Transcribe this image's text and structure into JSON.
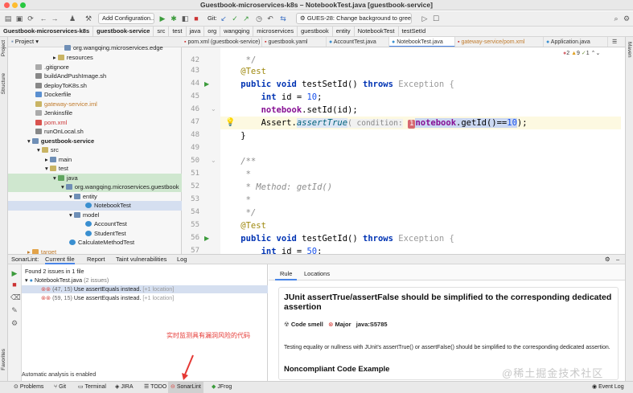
{
  "window": {
    "title": "Guestbook-microservices-k8s – NotebookTest.java [guestbook-service]"
  },
  "toolbar": {
    "add_config": "Add Configuration...",
    "git_label": "Git:",
    "branch": "GUES-28: Change background to green"
  },
  "breadcrumbs": [
    "Guestbook-microservices-k8s",
    "guestbook-service",
    "src",
    "test",
    "java",
    "org",
    "wangqing",
    "microservices",
    "guestbook",
    "entity",
    "NotebookTest",
    "testSetId"
  ],
  "side_strip": {
    "left_top": "Project",
    "left_mid": "Structure",
    "left_bottom": "Favorites",
    "right_top": "Maven"
  },
  "project": {
    "header": "Project",
    "items": [
      {
        "label": "org.wangqing.microservices.edge"
      },
      {
        "label": "resources"
      },
      {
        "label": ".gitignore"
      },
      {
        "label": "buildAndPushImage.sh"
      },
      {
        "label": "deployToK8s.sh"
      },
      {
        "label": "Dockerfile"
      },
      {
        "label": "gateway-service.iml"
      },
      {
        "label": "Jenkinsfile"
      },
      {
        "label": "pom.xml"
      },
      {
        "label": "runOnLocal.sh"
      },
      {
        "label": "guestbook-service"
      },
      {
        "label": "src"
      },
      {
        "label": "main"
      },
      {
        "label": "test"
      },
      {
        "label": "java"
      },
      {
        "label": "org.wangqing.microservices.guestbook"
      },
      {
        "label": "entity"
      },
      {
        "label": "NotebookTest"
      },
      {
        "label": "model"
      },
      {
        "label": "AccountTest"
      },
      {
        "label": "StudentTest"
      },
      {
        "label": "CalculateMethodTest"
      },
      {
        "label": "target"
      }
    ]
  },
  "editor_tabs": [
    "pom.xml (guestbook-service)",
    "guestbook.yaml",
    "AccountTest.java",
    "NotebookTest.java",
    "gateway-service/pom.xml",
    "Application.java"
  ],
  "warnings": {
    "errors": "2",
    "warns": "9",
    "other": "1"
  },
  "code": {
    "line_numbers": [
      "42",
      "43",
      "44",
      "45",
      "46",
      "47",
      "48",
      "49",
      "50",
      "51",
      "52",
      "53",
      "54",
      "55",
      "56",
      "57"
    ],
    "l42": "     */",
    "l43": "    @Test",
    "l44_kw": "public void",
    "l44_name": " testSetId()",
    "l44_throws": " throws",
    "l44_exc": " Exception {",
    "l45_kw": "int",
    "l45_rest": " id = ",
    "l45_num": "10",
    "l46_fld": "notebook",
    "l46_rest": ".setId(id);",
    "l47_pre": "Assert.",
    "l47_method": "assertTrue",
    "l47_hint": "( condition:",
    "l47_badge": "1",
    "l47_fld": "notebook",
    "l47_rest": ".getId()==",
    "l47_num": "10",
    "l47_end": ");",
    "l48": "    }",
    "l50": "    /**",
    "l51": "     *",
    "l52": "     * Method: getId()",
    "l53": "     *",
    "l54": "     */",
    "l55": "    @Test",
    "l56_kw": "public void",
    "l56_name": " testGetId()",
    "l56_throws": " throws",
    "l56_exc": " Exception {",
    "l57_kw": "int",
    "l57_rest": " id = ",
    "l57_num": "50",
    "l57_end": ";"
  },
  "sonar": {
    "tabs": [
      "SonarLint:",
      "Current file",
      "Report",
      "Taint vulnerabilities",
      "Log"
    ],
    "summary": "Found 2 issues in 1 file",
    "file": "NotebookTest.java",
    "file_count": "(2 issues)",
    "issues": [
      {
        "loc": "(47, 15)",
        "msg": "Use assertEquals instead.",
        "extra": "[+1 location]"
      },
      {
        "loc": "(59, 15)",
        "msg": "Use assertEquals instead.",
        "extra": "[+1 location]"
      }
    ],
    "annotation": "实时监测具有漏洞风险的代码",
    "auto_status": "Automatic analysis is enabled"
  },
  "rule": {
    "tabs": [
      "Rule",
      "Locations"
    ],
    "title": "JUnit assertTrue/assertFalse should be simplified to the corresponding dedicated assertion",
    "type": "Code smell",
    "severity": "Major",
    "key": "java:S5785",
    "description": "Testing equality or nullness with JUnit's assertTrue() or assertFalse() should be simplified to the corresponding dedicated assertion.",
    "subheading": "Noncompliant Code Example"
  },
  "watermark": "@稀土掘金技术社区",
  "statusbar": {
    "items": [
      "Problems",
      "Git",
      "Terminal",
      "JIRA",
      "TODO",
      "SonarLint",
      "JFrog"
    ],
    "event_log": "Event Log"
  },
  "colors": {
    "accent": "#4a86e8",
    "error": "#d6686f",
    "annotation": "#e53935",
    "keyword": "#0033b3"
  }
}
